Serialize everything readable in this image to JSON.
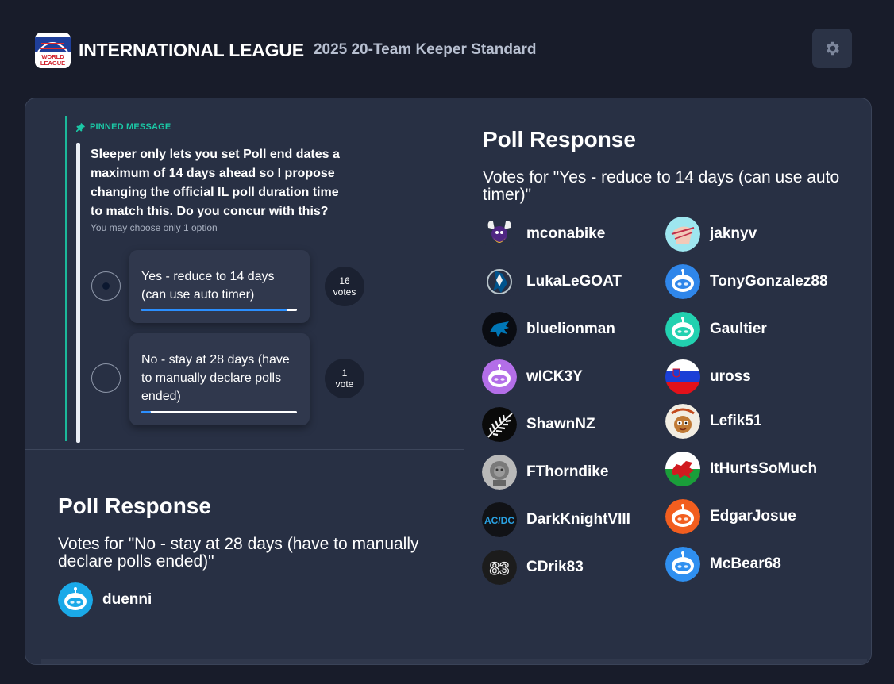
{
  "header": {
    "logo_text": "WORLD LEAGUE",
    "league_name": "INTERNATIONAL LEAGUE",
    "league_subtitle": "2025 20-Team Keeper Standard"
  },
  "pinned": {
    "label": "PINNED MESSAGE",
    "question": "Sleeper only lets you set Poll end dates a maximum of 14 days ahead so I propose changing the official IL poll duration time to match this. Do you concur with this?",
    "hint": "You may choose only 1 option",
    "options": [
      {
        "text": "Yes - reduce to 14 days (can use auto timer)",
        "count": "16",
        "unit": "votes",
        "share": 0.94,
        "selected": true
      },
      {
        "text": "No - stay at 28 days (have to manually declare polls ended)",
        "count": "1",
        "unit": "vote",
        "share": 0.06,
        "selected": false
      }
    ]
  },
  "response_yes": {
    "title": "Poll Response",
    "subtitle": "Votes for \"Yes - reduce to 14 days (can use auto timer)\"",
    "voters": [
      {
        "name": "mconabike",
        "icon": "vikings-logo"
      },
      {
        "name": "jaknyv",
        "icon": "photo-avatar"
      },
      {
        "name": "LukaLeGOAT",
        "icon": "mavericks-logo"
      },
      {
        "name": "TonyGonzalez88",
        "icon": "robot-avatar"
      },
      {
        "name": "bluelionman",
        "icon": "lions-logo"
      },
      {
        "name": "Gaultier",
        "icon": "robot-avatar"
      },
      {
        "name": "wICK3Y",
        "icon": "robot-avatar"
      },
      {
        "name": "uross",
        "icon": "slovenia-flag"
      },
      {
        "name": "ShawnNZ",
        "icon": "silver-fern"
      },
      {
        "name": "Lefik51",
        "icon": "cartoon-avatar"
      },
      {
        "name": "FThorndike",
        "icon": "lion-statue"
      },
      {
        "name": "ItHurtsSoMuch",
        "icon": "wales-flag"
      },
      {
        "name": "DarkKnightVIII",
        "icon": "acdc-logo"
      },
      {
        "name": "EdgarJosue",
        "icon": "robot-avatar"
      },
      {
        "name": "CDrik83",
        "icon": "jersey-83"
      },
      {
        "name": "McBear68",
        "icon": "robot-avatar"
      }
    ]
  },
  "response_no": {
    "title": "Poll Response",
    "subtitle": "Votes for \"No - stay at 28 days (have to manually declare polls ended)\"",
    "voters": [
      {
        "name": "duenni",
        "icon": "robot-avatar"
      }
    ]
  },
  "colors": {
    "background": "#181c2a",
    "card": "#283044",
    "accent_green": "#1bc8a6",
    "vote_bar": "#2b8fff"
  }
}
